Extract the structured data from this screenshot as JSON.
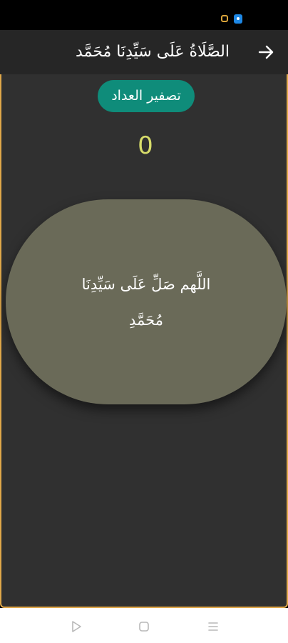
{
  "app_bar": {
    "title": "الصَّلَاةُ عَلَى سَيِّدِنَا مُحَمَّد",
    "back_icon": "arrow-right-icon"
  },
  "controls": {
    "reset_label": "تصفير العداد"
  },
  "counter": {
    "value": "0"
  },
  "dhikr": {
    "line1": "اللَّهم صَلِّ عَلَى سَيِّدِنَا",
    "line2": "مُحَمَّدِ"
  },
  "colors": {
    "accent": "#0f8c7a",
    "counter": "#d7dc6a",
    "dhikr_button": "#6a6a58",
    "border": "#e0a84a"
  },
  "nav": {
    "icons": [
      "play-triangle-icon",
      "square-home-icon",
      "menu-lines-icon"
    ]
  }
}
